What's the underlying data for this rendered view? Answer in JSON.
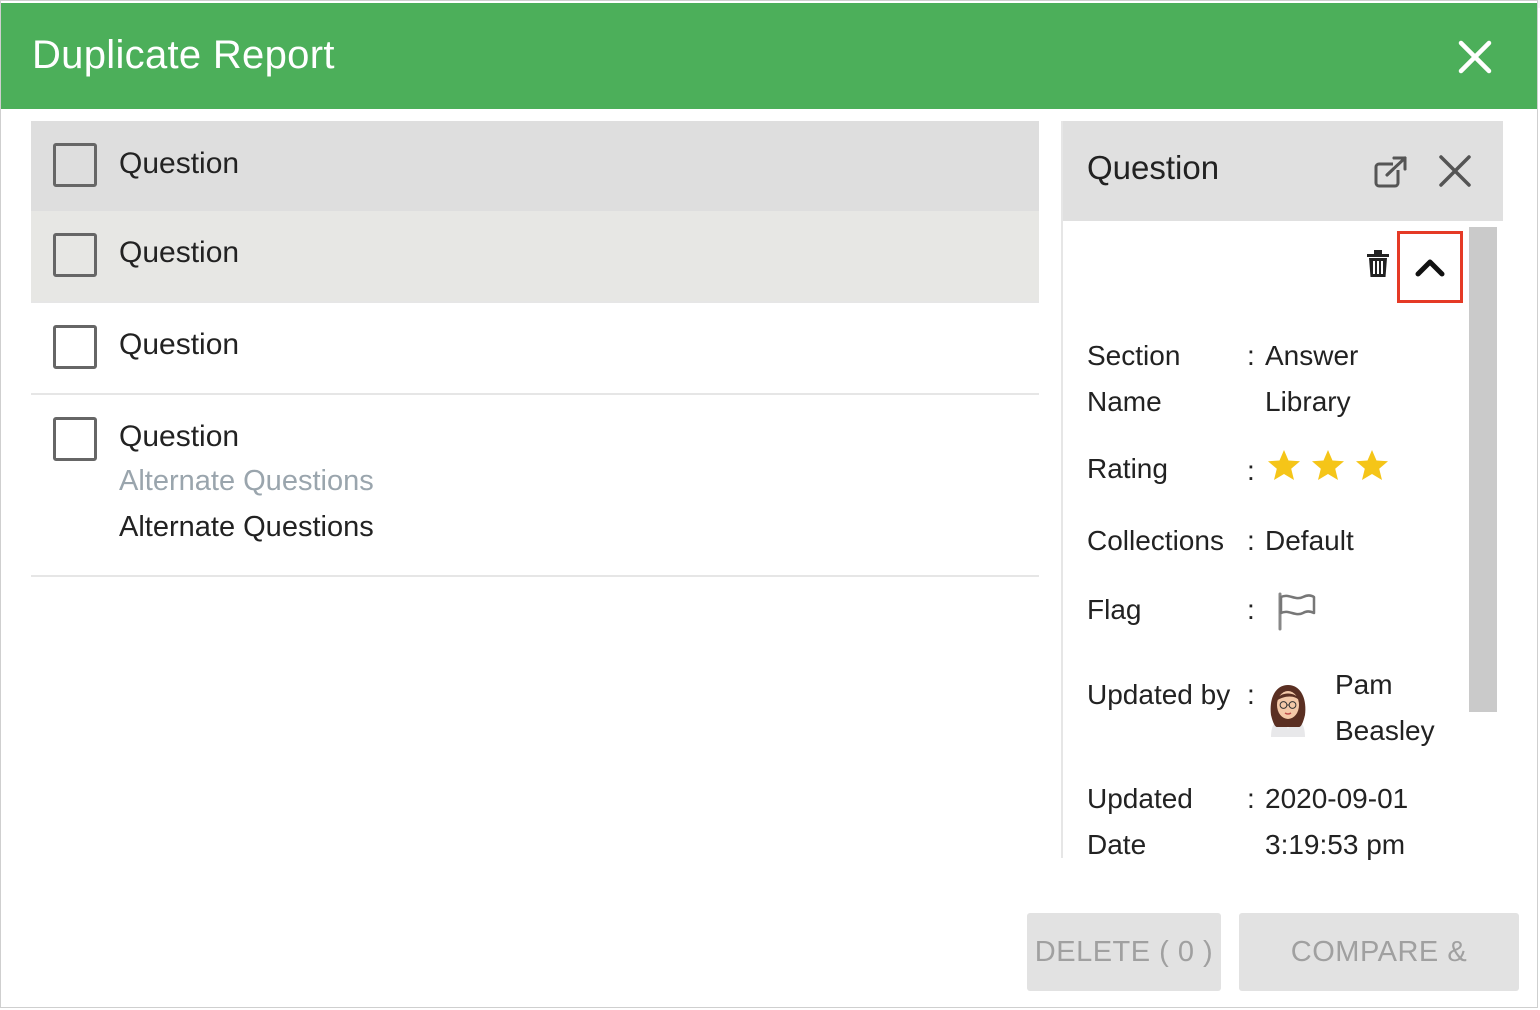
{
  "dialog": {
    "title": "Duplicate Report"
  },
  "list": {
    "items": [
      {
        "label": "Question"
      },
      {
        "label": "Question"
      },
      {
        "label": "Question"
      },
      {
        "label": "Question",
        "alternate_muted": "Alternate Questions",
        "alternate": "Alternate Questions"
      }
    ]
  },
  "detail": {
    "title": "Question",
    "fields": {
      "section_label_1": "Section",
      "section_label_2": "Name",
      "section_value_1": "Answer",
      "section_value_2": "Library",
      "rating_label": "Rating",
      "rating_value": 3,
      "collections_label": "Collections",
      "collections_value": "Default",
      "flag_label": "Flag",
      "updated_by_label": "Updated by",
      "updated_by_first": "Pam",
      "updated_by_last": "Beasley",
      "updated_date_label_1": "Updated",
      "updated_date_label_2": "Date",
      "updated_date_value_1": "2020-09-01",
      "updated_date_value_2": "3:19:53 pm"
    },
    "colon": ":"
  },
  "footer": {
    "delete_label": "DELETE ( 0 )",
    "merge_label": "COMPARE & MERGE"
  },
  "colors": {
    "header": "#4caf5a",
    "star": "#f5c518",
    "highlight": "#e53a26"
  }
}
